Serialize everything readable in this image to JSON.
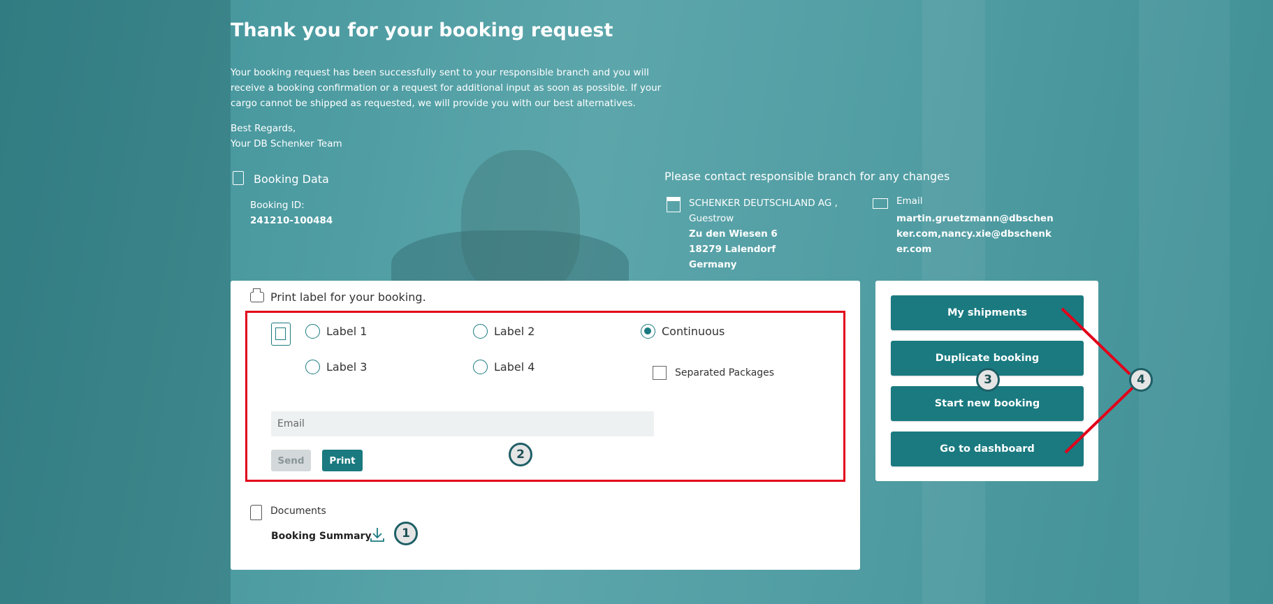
{
  "header": {
    "title": "Thank you for your booking request",
    "intro": "Your booking request has been successfully sent to your responsible branch and you will receive a booking confirmation or a request for additional input as soon as possible. If your cargo cannot be shipped as requested, we will provide you with our best alternatives.",
    "regards_line1": "Best Regards,",
    "regards_line2": "Your DB Schenker Team"
  },
  "booking_data": {
    "title": "Booking Data",
    "id_label": "Booking ID:",
    "id_value": "241210-100484"
  },
  "contact": {
    "title": "Please contact responsible branch for any changes",
    "company": "SCHENKER DEUTSCHLAND AG ,",
    "branch": "Guestrow",
    "street": "Zu den Wiesen 6",
    "city": "18279 Lalendorf",
    "country": "Germany",
    "email_label": "Email",
    "email_value": "martin.gruetzmann@dbschenker.com,nancy.xie@dbschenker.com"
  },
  "print_label": {
    "title": "Print label for your booking.",
    "options": {
      "label1": "Label 1",
      "label2": "Label 2",
      "continuous": "Continuous",
      "label3": "Label 3",
      "label4": "Label 4"
    },
    "selected": "Continuous",
    "separated_packages": "Separated Packages",
    "separated_checked": false,
    "email_placeholder": "Email",
    "send_label": "Send",
    "print_label": "Print"
  },
  "documents": {
    "title": "Documents",
    "booking_summary": "Booking Summary"
  },
  "actions": {
    "my_shipments": "My shipments",
    "duplicate_booking": "Duplicate booking",
    "start_new_booking": "Start new booking",
    "go_to_dashboard": "Go to dashboard"
  },
  "annotations": {
    "badge1": "1",
    "badge2": "2",
    "badge3": "3",
    "badge4": "4"
  },
  "colors": {
    "accent": "#1a7a80",
    "annotation_red": "#e2001a"
  }
}
